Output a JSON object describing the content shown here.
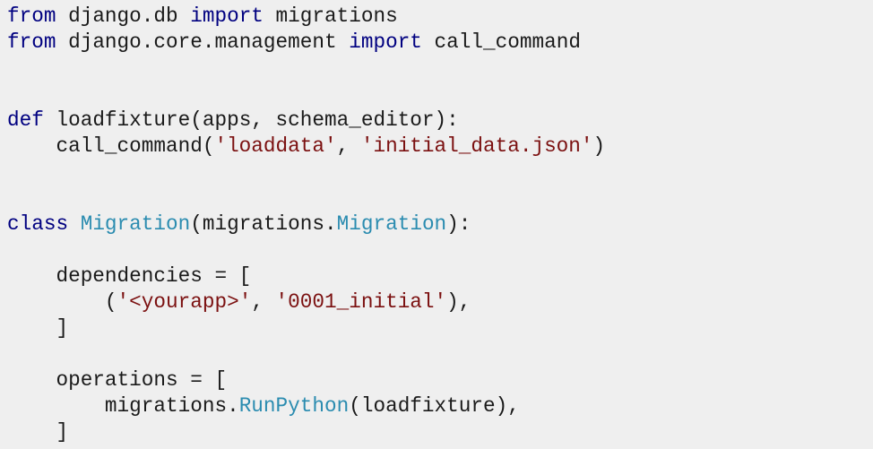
{
  "colors": {
    "background": "#efefef",
    "text": "#1a1a1a",
    "keyword": "#000080",
    "class_name": "#2b8cb0",
    "string": "#7b1010"
  },
  "code": {
    "lines": [
      [
        {
          "t": "kw",
          "v": "from"
        },
        {
          "t": "p",
          "v": " django.db "
        },
        {
          "t": "kw",
          "v": "import"
        },
        {
          "t": "p",
          "v": " migrations"
        }
      ],
      [
        {
          "t": "kw",
          "v": "from"
        },
        {
          "t": "p",
          "v": " django.core.management "
        },
        {
          "t": "kw",
          "v": "import"
        },
        {
          "t": "p",
          "v": " call_command"
        }
      ],
      [],
      [],
      [
        {
          "t": "kw",
          "v": "def"
        },
        {
          "t": "p",
          "v": " loadfixture(apps, schema_editor):"
        }
      ],
      [
        {
          "t": "p",
          "v": "    call_command("
        },
        {
          "t": "str",
          "v": "'loaddata'"
        },
        {
          "t": "p",
          "v": ", "
        },
        {
          "t": "str",
          "v": "'initial_data.json'"
        },
        {
          "t": "p",
          "v": ")"
        }
      ],
      [],
      [],
      [
        {
          "t": "kw",
          "v": "class"
        },
        {
          "t": "p",
          "v": " "
        },
        {
          "t": "cls",
          "v": "Migration"
        },
        {
          "t": "p",
          "v": "(migrations."
        },
        {
          "t": "cls",
          "v": "Migration"
        },
        {
          "t": "p",
          "v": "):"
        }
      ],
      [],
      [
        {
          "t": "p",
          "v": "    dependencies = ["
        }
      ],
      [
        {
          "t": "p",
          "v": "        ("
        },
        {
          "t": "str",
          "v": "'<yourapp>'"
        },
        {
          "t": "p",
          "v": ", "
        },
        {
          "t": "str",
          "v": "'0001_initial'"
        },
        {
          "t": "p",
          "v": "),"
        }
      ],
      [
        {
          "t": "p",
          "v": "    ]"
        }
      ],
      [],
      [
        {
          "t": "p",
          "v": "    operations = ["
        }
      ],
      [
        {
          "t": "p",
          "v": "        migrations."
        },
        {
          "t": "cls",
          "v": "RunPython"
        },
        {
          "t": "p",
          "v": "(loadfixture),"
        }
      ],
      [
        {
          "t": "p",
          "v": "    ]"
        }
      ]
    ]
  }
}
